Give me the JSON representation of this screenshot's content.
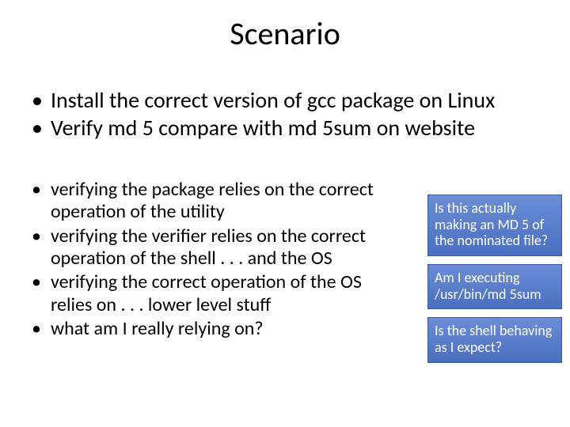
{
  "title": "Scenario",
  "top_bullets": [
    "Install the correct version of gcc package on Linux",
    "Verify md 5 compare with md 5sum on website"
  ],
  "sub_bullets": [
    "verifying the package relies on the correct operation of the utility",
    "verifying the verifier relies on the correct operation of the shell . . . and the OS",
    "verifying the correct operation of the OS relies on . . . lower level stuff",
    "what am I really relying on?"
  ],
  "callouts": [
    "Is this actually making an MD 5 of the nominated file?",
    "Am I executing /usr/bin/md 5sum",
    "Is the shell behaving as I expect?"
  ]
}
